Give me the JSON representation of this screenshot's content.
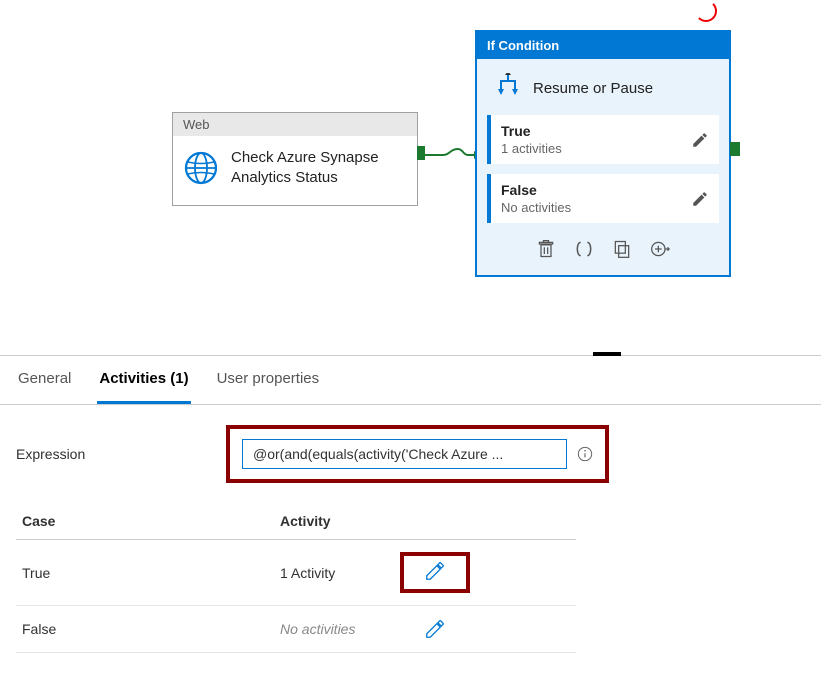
{
  "canvas": {
    "web_activity": {
      "type_label": "Web",
      "title": "Check Azure Synapse Analytics Status"
    },
    "if_condition": {
      "header": "If Condition",
      "title": "Resume or Pause",
      "true_branch": {
        "label": "True",
        "count_text": "1 activities"
      },
      "false_branch": {
        "label": "False",
        "count_text": "No activities"
      }
    }
  },
  "tabs": {
    "general": "General",
    "activities": "Activities (1)",
    "user_properties": "User properties"
  },
  "properties": {
    "expression_label": "Expression",
    "expression_value": "@or(and(equals(activity('Check Azure ..."
  },
  "case_table": {
    "header_case": "Case",
    "header_activity": "Activity",
    "rows": [
      {
        "case": "True",
        "activity": "1 Activity",
        "italic": false
      },
      {
        "case": "False",
        "activity": "No activities",
        "italic": true
      }
    ]
  }
}
